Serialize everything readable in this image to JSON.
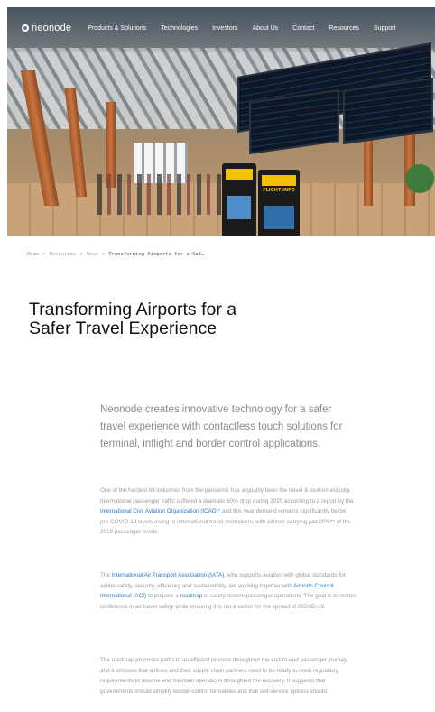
{
  "nav": {
    "logo": "neonode",
    "items": [
      "Products & Solutions",
      "Technologies",
      "Investors",
      "About Us",
      "Contact",
      "Resources",
      "Support"
    ]
  },
  "hero": {
    "kiosk_sign": "FLIGHT INFO"
  },
  "breadcrumb": {
    "items": [
      "Home",
      "Resources",
      "News"
    ],
    "separator": ">",
    "current": "Transforming Airports for a Saf…"
  },
  "article": {
    "title": "Transforming Airports for a Safer Travel Experience",
    "lead": "Neonode creates innovative technology for a safer travel experience with contactless touch solutions for terminal, inflight and border control applications.",
    "p1": {
      "t1": "One of the hardest hit industries from the pandemic has arguably been the travel & tourism industry. International passenger traffic suffered a dramatic 60% drop during 2020 according to a report by the ",
      "link1": "International Civil Aviation Organization (ICAO)",
      "t2": "* and this year demand remains significantly below pre-COVID-19 levels owing to international travel restrictions, with airlines carrying just 20%** of the 2019 passenger levels."
    },
    "p2": {
      "t1": "The ",
      "link1": "International Air Transport Association (IATA)",
      "t2": ", who supports aviation with global standards for airline safety, security, efficiency and sustainability, are working together with ",
      "link2": "Airports Council International (ACI)",
      "t3": " to prepare a ",
      "link3": "roadmap",
      "t4": " to safely restore passenger operations. The goal is to restore confidence in air travel safety while ensuring it is not a vector for the spread of COVID-19."
    },
    "p3": {
      "t1": "The roadmap proposes paths to an efficient process throughout the end-to-end passenger journey, and it stresses that airlines and their supply chain partners need to be ready to meet regulatory requirements to resume and maintain operations throughout the recovery. It suggests that governments should simplify border control formalities and that self-service options should"
    }
  },
  "colors": {
    "link": "#2a78c3",
    "title": "#111111",
    "body": "#9a9a9a"
  }
}
